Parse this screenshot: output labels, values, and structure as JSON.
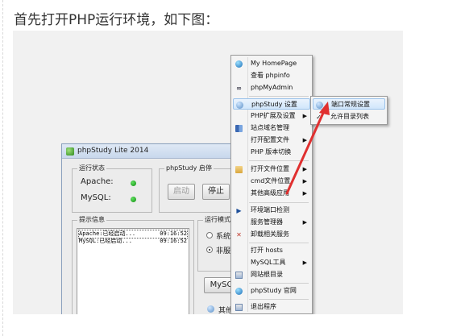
{
  "heading": "首先打开PHP运行环境，如下图：",
  "window": {
    "title": "phpStudy Lite 2014",
    "status_group": "运行状态",
    "apache_label": "Apache:",
    "mysql_label": "MySQL:",
    "start_group": "phpStudy 启停",
    "start_button": "启动",
    "stop_button": "停止",
    "info_group": "提示信息",
    "info_lines": [
      {
        "text": "Apache:已经启动...",
        "time": "09:16:52"
      },
      {
        "text": "MySQL:已经启动...",
        "time": "09:16:52"
      }
    ],
    "mode_group": "运行模式",
    "mode_options": [
      "系统",
      "非服"
    ],
    "mysql_button": "MySQ",
    "other_label": "其他"
  },
  "menu": {
    "items": [
      {
        "label": "My HomePage",
        "icon": "globe-icon"
      },
      {
        "label": "查看 phpinfo",
        "icon": ""
      },
      {
        "label": "phpMyAdmin",
        "icon": "link-icon"
      },
      {
        "label": "phpStudy 设置",
        "icon": "gear-icon",
        "highlighted": true,
        "submenu": true
      },
      {
        "label": "PHP扩展及设置",
        "icon": "",
        "submenu": true
      },
      {
        "label": "站点域名管理",
        "icon": "grid-icon"
      },
      {
        "label": "打开配置文件",
        "icon": "",
        "submenu": true
      },
      {
        "label": "PHP 版本切换",
        "icon": ""
      },
      {
        "label": "打开文件位置",
        "icon": "folder-icon",
        "submenu": true
      },
      {
        "label": "cmd文件位置",
        "icon": "",
        "submenu": true
      },
      {
        "label": "其他高级应用",
        "icon": "",
        "submenu": true
      },
      {
        "label": "环境端口检测",
        "icon": "arrow-icon"
      },
      {
        "label": "服务管理器",
        "icon": "",
        "submenu": true
      },
      {
        "label": "卸载相关服务",
        "icon": "x-icon"
      },
      {
        "label": "打开 hosts",
        "icon": ""
      },
      {
        "label": "MySQL工具",
        "icon": "",
        "submenu": true
      },
      {
        "label": "网站根目录",
        "icon": "disk-icon"
      },
      {
        "label": "phpStudy 官网",
        "icon": "globe-icon"
      },
      {
        "label": "退出程序",
        "icon": "exit-icon"
      }
    ]
  },
  "submenu": {
    "items": [
      {
        "label": "端口常规设置",
        "highlighted": true
      },
      {
        "label": "允许目录列表",
        "checked": true
      }
    ]
  },
  "colors": {
    "accent_arrow": "#e03030",
    "led_green": "#1fa31f"
  }
}
